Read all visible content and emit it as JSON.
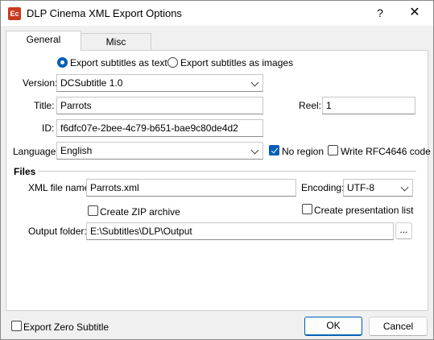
{
  "window": {
    "title": "DLP Cinema XML Export Options",
    "icon_text": "Ec",
    "help_glyph": "?",
    "close_glyph": "✕"
  },
  "tabs": [
    {
      "label": "General",
      "active": true
    },
    {
      "label": "Misc",
      "active": false
    }
  ],
  "general": {
    "export_mode": {
      "text_label": "Export subtitles as text",
      "images_label": "Export subtitles as images",
      "selected": "text"
    },
    "version": {
      "label": "Version:",
      "value": "DCSubtitle 1.0"
    },
    "title": {
      "label": "Title:",
      "value": "Parrots"
    },
    "reel": {
      "label": "Reel:",
      "value": "1"
    },
    "id": {
      "label": "ID:",
      "value": "f6dfc07e-2bee-4c79-b651-bae9c80de4d2"
    },
    "language": {
      "label": "Language:",
      "value": "English"
    },
    "no_region": {
      "label": "No region",
      "checked": true
    },
    "write_rfc": {
      "label": "Write RFC4646 code",
      "checked": false
    },
    "files": {
      "heading": "Files",
      "xml_file_name": {
        "label": "XML file name:",
        "value": "Parrots.xml"
      },
      "encoding": {
        "label": "Encoding:",
        "value": "UTF-8"
      },
      "create_zip": {
        "label": "Create ZIP archive",
        "checked": false
      },
      "create_presentation_list": {
        "label": "Create presentation list",
        "checked": false
      },
      "output_folder": {
        "label": "Output folder:",
        "value": "E:\\Subtitles\\DLP\\Output",
        "browse_label": "..."
      }
    }
  },
  "footer": {
    "export_zero_subtitle": {
      "label": "Export Zero Subtitle",
      "checked": false
    },
    "ok_label": "OK",
    "cancel_label": "Cancel"
  },
  "colors": {
    "accent": "#005fb8",
    "app_icon": "#c8391f"
  }
}
